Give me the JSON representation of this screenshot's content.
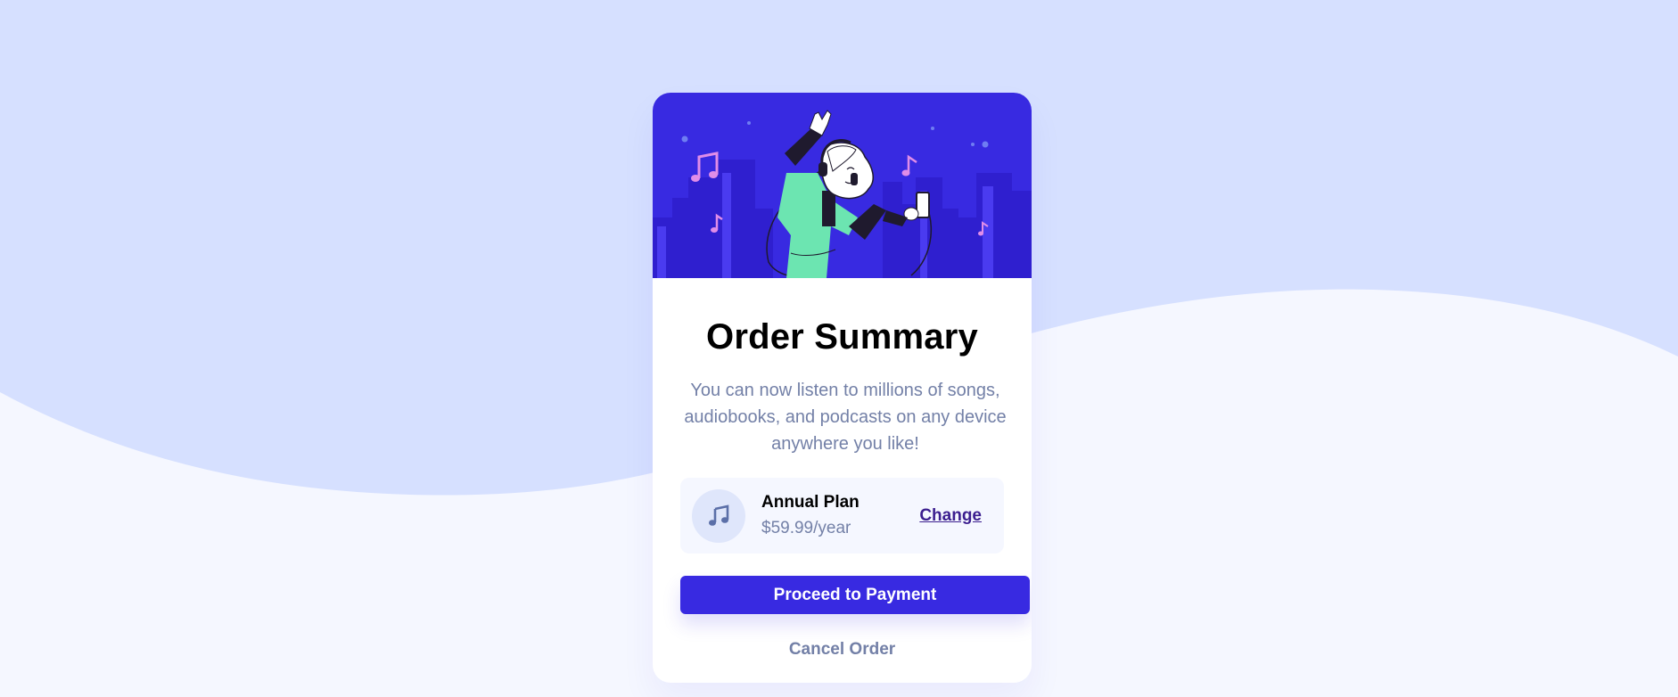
{
  "colors": {
    "background_top": "#d6e0ff",
    "background_bottom": "#f5f7ff",
    "accent": "#382ae1",
    "text_dark": "#000000",
    "text_muted": "#7380a7",
    "plan_bg": "#f5f7ff",
    "icon_bg": "#dfe6fb"
  },
  "hero": {
    "illustration": "person-dancing-with-headphones-illustration"
  },
  "card": {
    "title": "Order Summary",
    "description": "You can now listen to millions of songs, audiobooks, and podcasts on any device anywhere you like!"
  },
  "plan": {
    "icon": "music-note-icon",
    "name": "Annual Plan",
    "price": "$59.99/year",
    "change_label": "Change"
  },
  "actions": {
    "proceed_label": "Proceed to Payment",
    "cancel_label": "Cancel Order"
  }
}
